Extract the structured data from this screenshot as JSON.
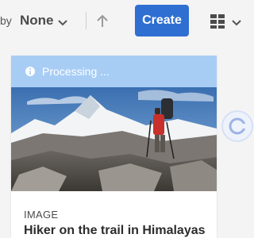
{
  "toolbar": {
    "sort_label": "by",
    "sort_value": "None",
    "create_label": "Create"
  },
  "card": {
    "status": "Processing ...",
    "type": "IMAGE",
    "title": "Hiker on the trail in Himalayas"
  },
  "colors": {
    "accent": "#2f6fd1",
    "status_bar": "#a8cdf5"
  },
  "icons": {
    "sort_chevron": "chevron-down-icon",
    "sort_direction": "arrow-up-icon",
    "view_switcher": "grid-view-icon",
    "status": "info-icon"
  }
}
